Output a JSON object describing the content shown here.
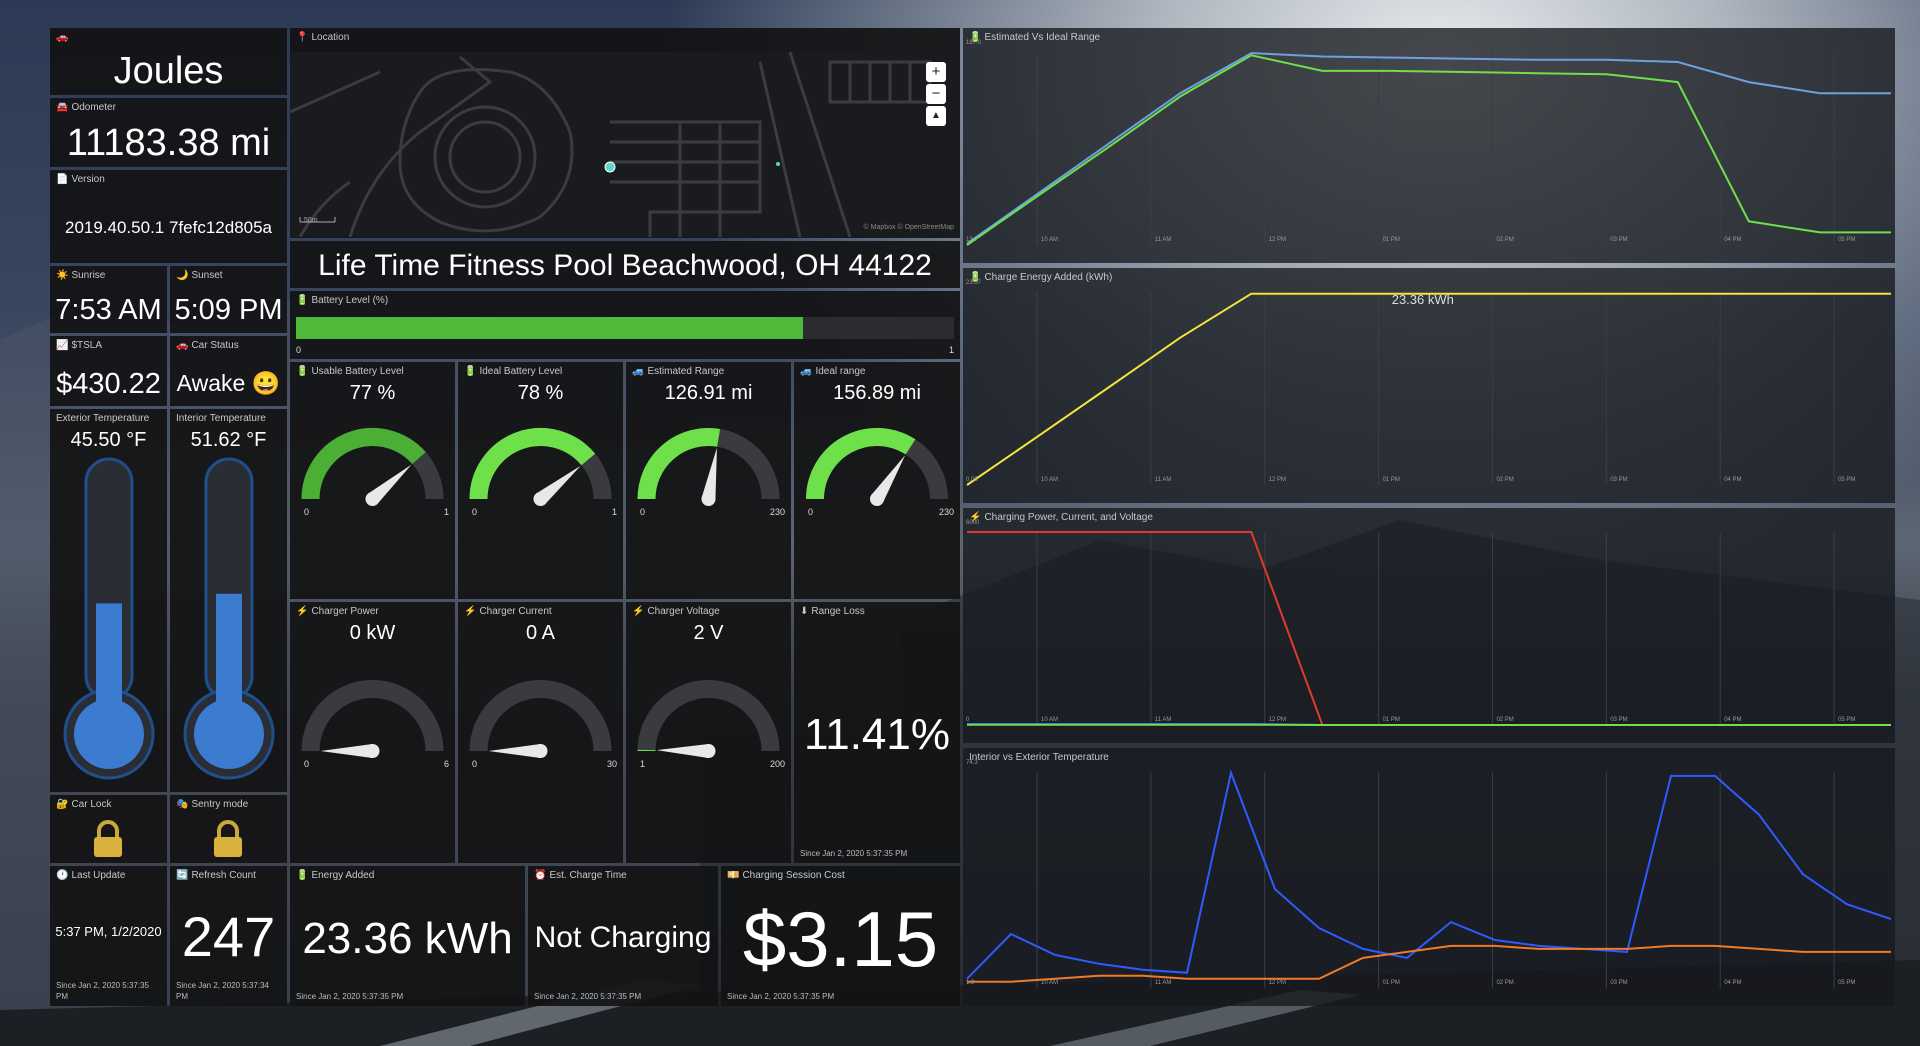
{
  "car": {
    "name": "Joules",
    "icon": "car-icon"
  },
  "odometer": {
    "title": "Odometer",
    "value": "11183.38 mi"
  },
  "version": {
    "title": "Version",
    "value": "2019.40.50.1 7fefc12d805a"
  },
  "sunrise": {
    "title": "Sunrise",
    "value": "7:53 AM"
  },
  "sunset": {
    "title": "Sunset",
    "value": "5:09 PM"
  },
  "stock": {
    "title": "$TSLA",
    "value": "$430.22"
  },
  "car_status": {
    "title": "Car Status",
    "value": "Awake 😀"
  },
  "ext_temp": {
    "title": "Exterior Temperature",
    "value": "45.50 °F",
    "fill_fraction": 0.44
  },
  "int_temp": {
    "title": "Interior Temperature",
    "value": "51.62 °F",
    "fill_fraction": 0.48
  },
  "car_lock": {
    "title": "Car Lock",
    "icon": "padlock-icon"
  },
  "sentry": {
    "title": "Sentry mode",
    "icon": "padlock-icon"
  },
  "location": {
    "title": "Location",
    "address": "Life Time Fitness Pool Beachwood, OH 44122",
    "scale": "50m",
    "attribution": "© Mapbox © OpenStreetMap",
    "zoom_in": "+",
    "zoom_out": "−",
    "compass": "▲"
  },
  "battery": {
    "title": "Battery Level (%)",
    "level": 0.77,
    "min": "0",
    "max": "1"
  },
  "gauges_row1": [
    {
      "title": "Usable Battery Level",
      "value": "77 %",
      "min": "0",
      "max": "1",
      "fraction": 0.77,
      "color": "#4caf35"
    },
    {
      "title": "Ideal Battery Level",
      "value": "78 %",
      "min": "0",
      "max": "1",
      "fraction": 0.78,
      "color": "#6ee04a"
    },
    {
      "title": "Estimated Range",
      "value": "126.91 mi",
      "min": "0",
      "max": "230",
      "fraction": 0.552,
      "color": "#6ee04a"
    },
    {
      "title": "Ideal range",
      "value": "156.89 mi",
      "min": "0",
      "max": "230",
      "fraction": 0.682,
      "color": "#6ee04a"
    }
  ],
  "gauges_row2": [
    {
      "title": "Charger Power",
      "value": "0 kW",
      "min": "0",
      "max": "6",
      "fraction": 0.0,
      "color": "#6ee04a"
    },
    {
      "title": "Charger Current",
      "value": "0 A",
      "min": "0",
      "max": "30",
      "fraction": 0.0,
      "color": "#6ee04a"
    },
    {
      "title": "Charger Voltage",
      "value": "2 V",
      "min": "1",
      "max": "200",
      "fraction": 0.005,
      "color": "#6ee04a"
    }
  ],
  "range_loss": {
    "title": "Range Loss",
    "value": "11.41%",
    "since": "Since Jan 2, 2020 5:37:35 PM"
  },
  "last_update": {
    "title": "Last Update",
    "value": "5:37 PM, 1/2/2020",
    "since": "Since Jan 2, 2020 5:37:35 PM"
  },
  "refresh_count": {
    "title": "Refresh Count",
    "value": "247",
    "since": "Since Jan 2, 2020 5:37:34 PM"
  },
  "energy_added": {
    "title": "Energy Added",
    "value": "23.36 kWh",
    "since": "Since Jan 2, 2020 5:37:35 PM"
  },
  "charge_time": {
    "title": "Est. Charge Time",
    "value": "Not Charging",
    "since": "Since Jan 2, 2020 5:37:35 PM"
  },
  "session_cost": {
    "title": "Charging Session Cost",
    "value": "$3.15",
    "since": "Since Jan 2, 2020 5:37:35 PM"
  },
  "chart_data": [
    {
      "type": "line",
      "title": "Estimated Vs Ideal Range",
      "x": [
        "10 AM",
        "11 AM",
        "12 PM",
        "01 PM",
        "02 PM",
        "03 PM",
        "04 PM",
        "05 PM"
      ],
      "ylim": [
        13.7,
        187.0
      ],
      "ymax_label": "187.0",
      "ymin_label": "13.7",
      "series": [
        {
          "color": "#6fa0e0",
          "values": [
            15,
            60,
            105,
            150,
            186,
            183,
            182,
            181,
            180,
            180,
            178,
            160,
            150,
            150
          ]
        },
        {
          "color": "#6ee04a",
          "values": [
            13.7,
            58,
            102,
            147,
            184,
            170,
            170,
            169,
            168,
            167,
            160,
            35,
            25,
            25
          ]
        }
      ]
    },
    {
      "type": "line",
      "title": "Charge Energy Added (kWh)",
      "annotation": "23.36 kWh",
      "x": [
        "10 AM",
        "11 AM",
        "12 PM",
        "01 PM",
        "02 PM",
        "03 PM",
        "04 PM",
        "05 PM"
      ],
      "ylim": [
        0.06,
        23.57
      ],
      "ymax_label": "23.57",
      "ymin_label": "0.06",
      "series": [
        {
          "color": "#f2e63a",
          "values": [
            0.06,
            6,
            12,
            18,
            23.36,
            23.36,
            23.36,
            23.36,
            23.36,
            23.36,
            23.36,
            23.36,
            23.36,
            23.36
          ]
        }
      ]
    },
    {
      "type": "line",
      "title": "Charging Power, Current, and Voltage",
      "x": [
        "10 AM",
        "11 AM",
        "12 PM",
        "01 PM",
        "02 PM",
        "03 PM",
        "04 PM",
        "05 PM"
      ],
      "ylim": [
        0,
        6000
      ],
      "ymax_label": "6000",
      "ymin_label": "0",
      "series": [
        {
          "color": "#e03a2a",
          "values": [
            6000,
            6000,
            6000,
            6000,
            6000,
            0,
            0,
            0,
            0,
            0,
            0,
            0,
            0,
            0
          ]
        },
        {
          "color": "#2e5bff",
          "values": [
            30,
            30,
            30,
            30,
            30,
            0,
            0,
            0,
            0,
            0,
            0,
            0,
            0,
            0
          ]
        },
        {
          "color": "#6ee04a",
          "values": [
            10,
            10,
            10,
            10,
            10,
            0,
            0,
            0,
            0,
            0,
            0,
            0,
            0,
            0
          ]
        }
      ]
    },
    {
      "type": "line",
      "title": "Interior vs Exterior Temperature",
      "x": [
        "10 AM",
        "11 AM",
        "12 PM",
        "01 PM",
        "02 PM",
        "03 PM",
        "04 PM",
        "05 PM"
      ],
      "ylim": [
        1.9,
        74.3
      ],
      "ymax_label": "74.3",
      "ymin_label": "1.9",
      "series": [
        {
          "color": "#2e5bff",
          "values": [
            5,
            20,
            13,
            10,
            8,
            7,
            74,
            35,
            22,
            15,
            12,
            24,
            18,
            16,
            15,
            14,
            73,
            73,
            60,
            40,
            30,
            25
          ]
        },
        {
          "color": "#f07a28",
          "values": [
            4,
            4,
            5,
            6,
            6,
            5,
            5,
            5,
            5,
            12,
            14,
            16,
            16,
            15,
            15,
            15,
            16,
            16,
            15,
            14,
            14,
            14
          ]
        }
      ]
    }
  ]
}
